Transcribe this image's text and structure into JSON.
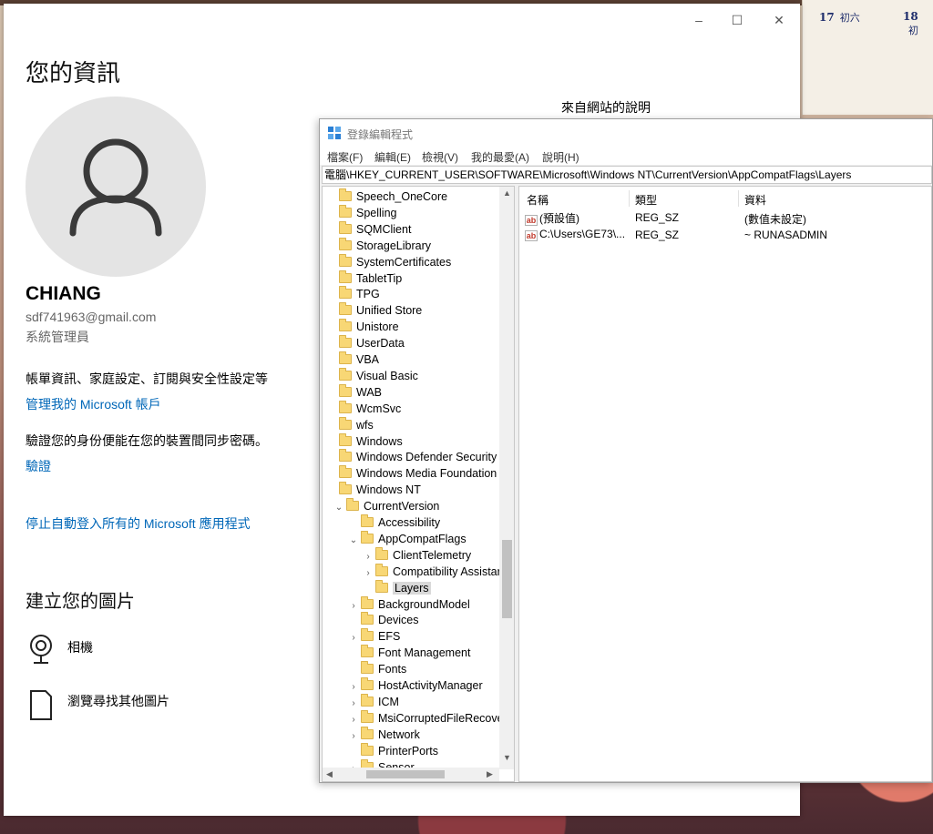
{
  "calendar": {
    "cells": [
      {
        "day": "17",
        "lunar": "初六"
      },
      {
        "day": "18",
        "lunar": "初"
      }
    ]
  },
  "settings": {
    "caption_buttons": {
      "minimize": "–",
      "maximize": "☐",
      "close": "✕"
    },
    "title": "您的資訊",
    "help_header": "來自網站的說明",
    "user": {
      "name": "CHIANG",
      "email": "sdf741963@gmail.com",
      "role": "系統管理員"
    },
    "account_text": "帳單資訊、家庭設定、訂閱與安全性設定等",
    "manage_link": "管理我的 Microsoft 帳戶",
    "verify_text": "驗證您的身份便能在您的裝置間同步密碼。",
    "verify_link": "驗證",
    "stop_autologin_link": "停止自動登入所有的 Microsoft 應用程式",
    "create_picture_title": "建立您的圖片",
    "options": [
      {
        "icon": "webcam-icon",
        "label": "相機"
      },
      {
        "icon": "browse-file-icon",
        "label": "瀏覽尋找其他圖片"
      }
    ]
  },
  "regedit": {
    "title": "登錄編輯程式",
    "menu": [
      "檔案(F)",
      "編輯(E)",
      "檢視(V)",
      "我的最愛(A)",
      "說明(H)"
    ],
    "address": "電腦\\HKEY_CURRENT_USER\\SOFTWARE\\Microsoft\\Windows NT\\CurrentVersion\\AppCompatFlags\\Layers",
    "tree": [
      {
        "label": "Speech_OneCore",
        "level": 0,
        "chevron": ""
      },
      {
        "label": "Spelling",
        "level": 0,
        "chevron": ""
      },
      {
        "label": "SQMClient",
        "level": 0,
        "chevron": ""
      },
      {
        "label": "StorageLibrary",
        "level": 0,
        "chevron": ""
      },
      {
        "label": "SystemCertificates",
        "level": 0,
        "chevron": ""
      },
      {
        "label": "TabletTip",
        "level": 0,
        "chevron": ""
      },
      {
        "label": "TPG",
        "level": 0,
        "chevron": ""
      },
      {
        "label": "Unified Store",
        "level": 0,
        "chevron": ""
      },
      {
        "label": "Unistore",
        "level": 0,
        "chevron": ""
      },
      {
        "label": "UserData",
        "level": 0,
        "chevron": ""
      },
      {
        "label": "VBA",
        "level": 0,
        "chevron": ""
      },
      {
        "label": "Visual Basic",
        "level": 0,
        "chevron": ""
      },
      {
        "label": "WAB",
        "level": 0,
        "chevron": ""
      },
      {
        "label": "WcmSvc",
        "level": 0,
        "chevron": ""
      },
      {
        "label": "wfs",
        "level": 0,
        "chevron": ""
      },
      {
        "label": "Windows",
        "level": 0,
        "chevron": ""
      },
      {
        "label": "Windows Defender Security Ce",
        "level": 0,
        "chevron": ""
      },
      {
        "label": "Windows Media Foundation",
        "level": 0,
        "chevron": ""
      },
      {
        "label": "Windows NT",
        "level": 0,
        "chevron": ""
      },
      {
        "label": "CurrentVersion",
        "level": 1,
        "chevron": "⌄"
      },
      {
        "label": "Accessibility",
        "level": 2,
        "chevron": ""
      },
      {
        "label": "AppCompatFlags",
        "level": 2,
        "chevron": "⌄"
      },
      {
        "label": "ClientTelemetry",
        "level": 3,
        "chevron": "›"
      },
      {
        "label": "Compatibility Assistar",
        "level": 3,
        "chevron": "›"
      },
      {
        "label": "Layers",
        "level": 3,
        "chevron": "",
        "selected": true
      },
      {
        "label": "BackgroundModel",
        "level": 2,
        "chevron": "›"
      },
      {
        "label": "Devices",
        "level": 2,
        "chevron": ""
      },
      {
        "label": "EFS",
        "level": 2,
        "chevron": "›"
      },
      {
        "label": "Font Management",
        "level": 2,
        "chevron": ""
      },
      {
        "label": "Fonts",
        "level": 2,
        "chevron": ""
      },
      {
        "label": "HostActivityManager",
        "level": 2,
        "chevron": "›"
      },
      {
        "label": "ICM",
        "level": 2,
        "chevron": "›"
      },
      {
        "label": "MsiCorruptedFileRecove",
        "level": 2,
        "chevron": "›"
      },
      {
        "label": "Network",
        "level": 2,
        "chevron": "›"
      },
      {
        "label": "PrinterPorts",
        "level": 2,
        "chevron": ""
      },
      {
        "label": "Sensor",
        "level": 2,
        "chevron": "›"
      }
    ],
    "columns": [
      "名稱",
      "類型",
      "資料"
    ],
    "values": [
      {
        "name": "(預設值)",
        "type": "REG_SZ",
        "data": "(數值未設定)"
      },
      {
        "name": "C:\\Users\\GE73\\...",
        "type": "REG_SZ",
        "data": "~ RUNASADMIN"
      }
    ]
  }
}
